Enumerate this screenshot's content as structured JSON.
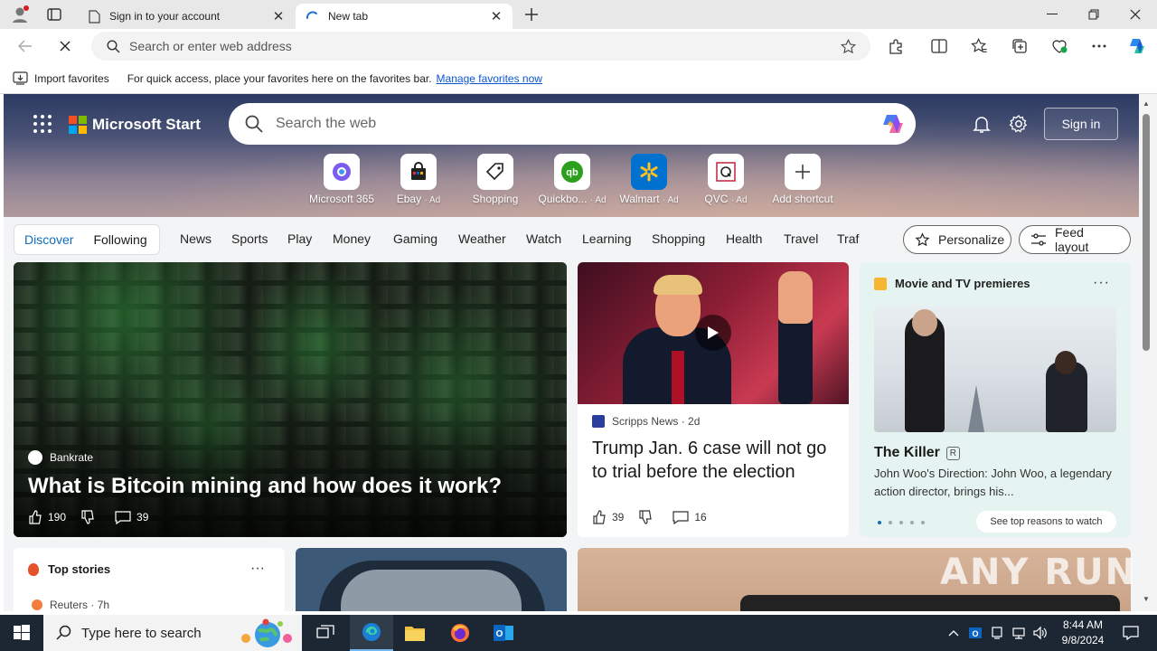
{
  "browser": {
    "tabs": [
      {
        "label": "Sign in to your account",
        "active": false
      },
      {
        "label": "New tab",
        "active": true
      }
    ],
    "address_placeholder": "Search or enter web address"
  },
  "favorites_bar": {
    "import_label": "Import favorites",
    "message": "For quick access, place your favorites here on the favorites bar.",
    "manage_link": "Manage favorites now"
  },
  "start": {
    "brand": "Microsoft Start",
    "search_placeholder": "Search the web",
    "signin_label": "Sign in",
    "shortcuts": [
      {
        "label": "Microsoft 365",
        "ad": ""
      },
      {
        "label": "Ebay",
        "ad": "· Ad"
      },
      {
        "label": "Shopping",
        "ad": ""
      },
      {
        "label": "Quickbo...",
        "ad": "· Ad"
      },
      {
        "label": "Walmart",
        "ad": "· Ad"
      },
      {
        "label": "QVC",
        "ad": "· Ad"
      },
      {
        "label": "Add shortcut",
        "ad": ""
      }
    ],
    "feed_tabs": [
      "Discover",
      "Following"
    ],
    "categories": [
      "News",
      "Sports",
      "Play",
      "Money",
      "Gaming",
      "Weather",
      "Watch",
      "Learning",
      "Shopping",
      "Health",
      "Travel",
      "Traf"
    ],
    "personalize_label": "Personalize",
    "feed_layout_label": "Feed layout"
  },
  "cards": {
    "main": {
      "source": "Bankrate",
      "headline": "What is Bitcoin mining and how does it work?",
      "likes": "190",
      "comments": "39"
    },
    "second": {
      "source": "Scripps News",
      "age": "· 2d",
      "headline": "Trump Jan. 6 case will not go to trial before the election",
      "likes": "39",
      "comments": "16"
    },
    "movies": {
      "header": "Movie and TV premieres",
      "title": "The Killer",
      "rating": "R",
      "description": "John Woo's Direction: John Woo, a legendary action director, brings his...",
      "button": "See top reasons to watch"
    },
    "top_stories": {
      "header": "Top stories",
      "source": "Reuters",
      "age": "· 7h"
    }
  },
  "watermark": "ANY RUN",
  "taskbar": {
    "search_placeholder": "Type here to search",
    "time": "8:44 AM",
    "date": "9/8/2024"
  }
}
